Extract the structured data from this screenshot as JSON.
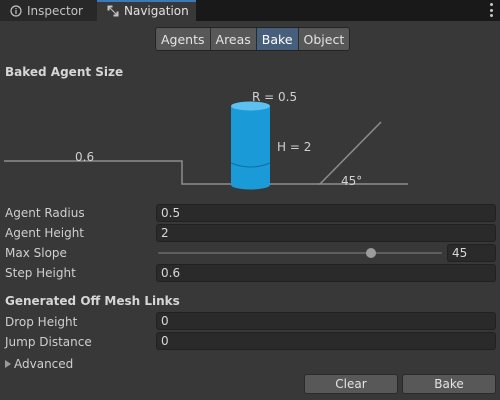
{
  "tabs": [
    {
      "label": "Inspector",
      "icon": "info-icon"
    },
    {
      "label": "Navigation",
      "icon": "navigation-icon"
    }
  ],
  "toolbar": {
    "buttons": [
      "Agents",
      "Areas",
      "Bake",
      "Object"
    ],
    "active": "Bake"
  },
  "agent_size": {
    "heading": "Baked Agent Size",
    "radius_text": "R = 0.5",
    "height_text": "H = 2",
    "step_text": "0.6",
    "slope_text": "45°"
  },
  "fields": {
    "agent_radius": {
      "label": "Agent Radius",
      "value": "0.5"
    },
    "agent_height": {
      "label": "Agent Height",
      "value": "2"
    },
    "max_slope": {
      "label": "Max Slope",
      "value": "45",
      "fraction": 0.75
    },
    "step_height": {
      "label": "Step Height",
      "value": "0.6"
    }
  },
  "offmesh": {
    "heading": "Generated Off Mesh Links",
    "drop_height": {
      "label": "Drop Height",
      "value": "0"
    },
    "jump_distance": {
      "label": "Jump Distance",
      "value": "0"
    }
  },
  "advanced_label": "Advanced",
  "buttons": {
    "clear": "Clear",
    "bake": "Bake"
  },
  "colors": {
    "accent": "#3a79bb",
    "agent": "#1b9ad8",
    "active_tab": "#46607c"
  }
}
